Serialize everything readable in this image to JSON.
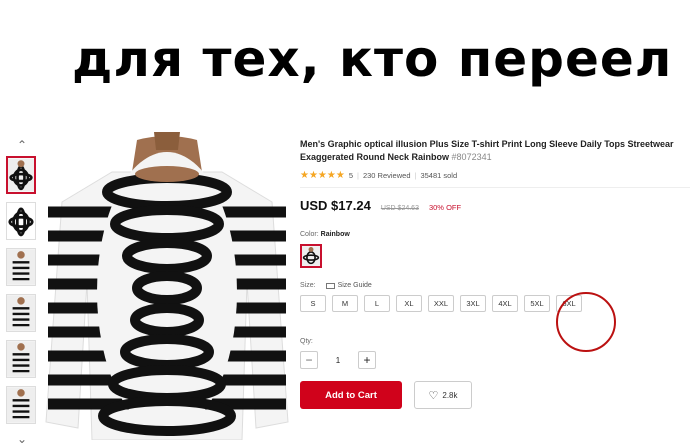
{
  "meme": {
    "caption": "для тех, кто переел"
  },
  "gallery": {
    "up_arrow": "^",
    "down_arrow": "v",
    "thumbnail_count": 6
  },
  "product": {
    "title": "Men's Graphic optical illusion Plus Size T-shirt Print Long Sleeve Daily Tops Streetwear Exaggerated Round Neck Rainbow",
    "sku": "#8072341",
    "rating": {
      "stars": "★★★★★",
      "score": "5",
      "reviews": "230 Reviewed",
      "sold": "35481 sold"
    },
    "price": {
      "current": "USD $17.24",
      "original": "USD $24.63",
      "discount": "30% OFF"
    },
    "color": {
      "label": "Color:",
      "value": "Rainbow"
    },
    "size": {
      "label": "Size:",
      "guide": "Size Guide",
      "options": [
        "S",
        "M",
        "L",
        "XL",
        "XXL",
        "3XL",
        "4XL",
        "5XL",
        "6XL"
      ]
    },
    "qty": {
      "label": "Qty:",
      "value": "1",
      "minus": "−",
      "plus": "+"
    },
    "actions": {
      "add_to_cart": "Add to Cart",
      "wishlist_count": "2.8k"
    }
  },
  "colors": {
    "accent": "#d0021b",
    "stars": "#f5a623",
    "annotation": "#bb1111"
  }
}
